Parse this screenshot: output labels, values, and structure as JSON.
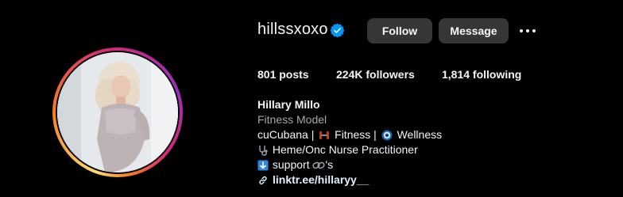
{
  "profile": {
    "username": "hillssxoxo",
    "verified_icon": "verified-badge-icon",
    "follow_label": "Follow",
    "message_label": "Message",
    "more_icon": "more-options-icon"
  },
  "stats": {
    "posts": "801 posts",
    "followers": "224K followers",
    "following": "1,814 following"
  },
  "bio": {
    "name": "Hillary Millo",
    "category": "Fitness Model",
    "line1_a": "cuCubana | ",
    "line1_b": " Fitness | ",
    "line1_c": " Wellness",
    "line2": " Heme/Onc Nurse Practitioner",
    "line3_a": " support ",
    "line3_b": "'s",
    "link": "linktr.ee/hillaryy__"
  },
  "colors": {
    "background": "#000000",
    "button_bg": "#363636",
    "verified_blue": "#0095f6",
    "muted_text": "#a8a8a8"
  }
}
